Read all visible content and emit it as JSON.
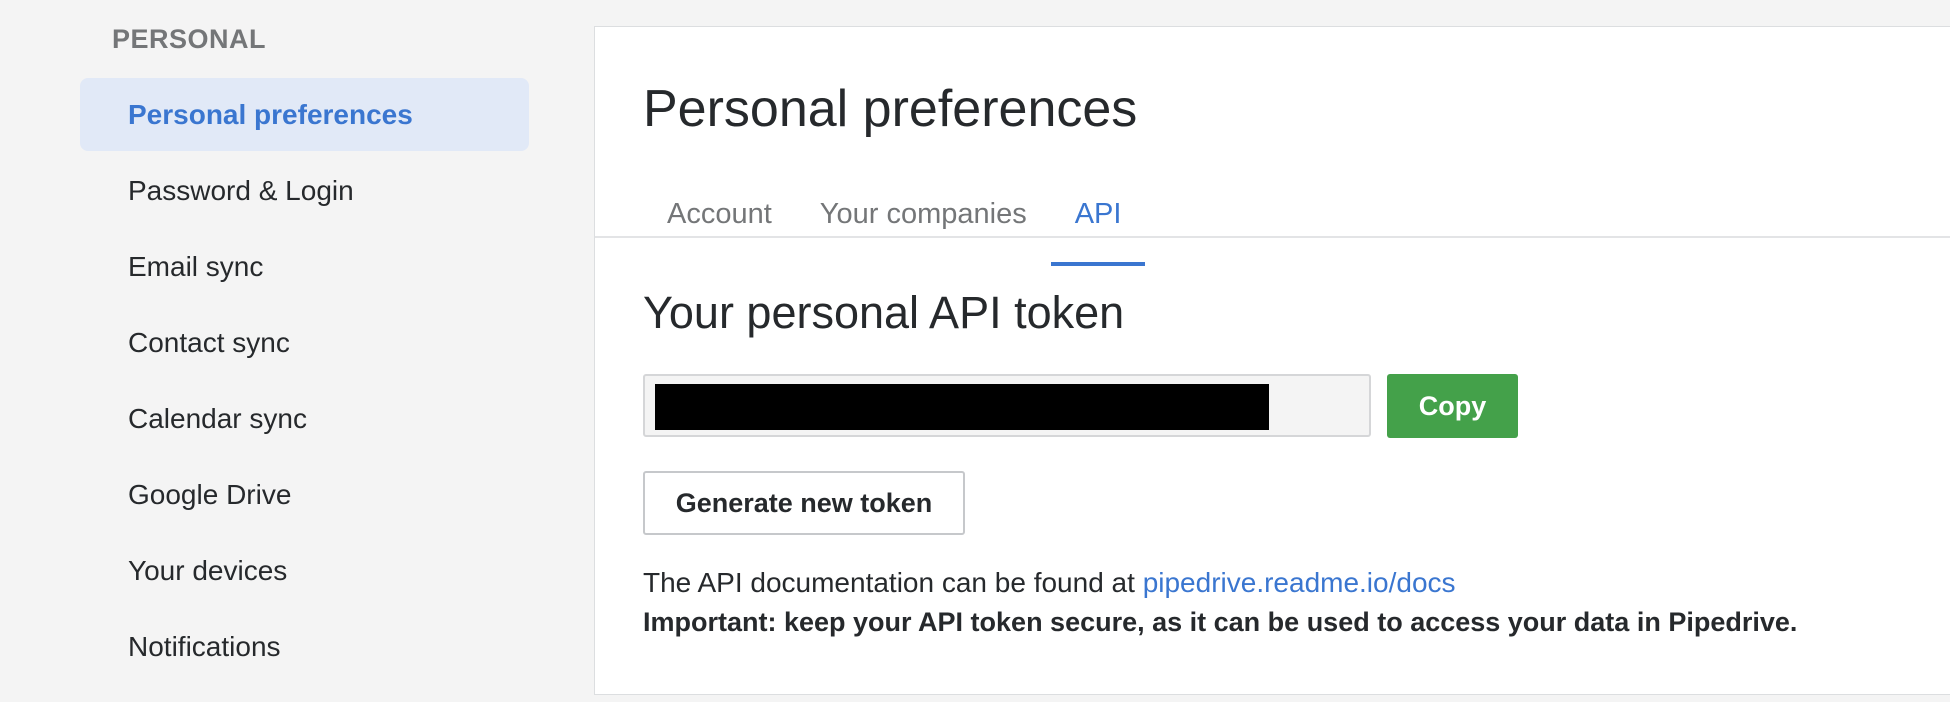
{
  "sidebar": {
    "heading": "PERSONAL",
    "items": [
      {
        "label": "Personal preferences",
        "active": true
      },
      {
        "label": "Password & Login",
        "active": false
      },
      {
        "label": "Email sync",
        "active": false
      },
      {
        "label": "Contact sync",
        "active": false
      },
      {
        "label": "Calendar sync",
        "active": false
      },
      {
        "label": "Google Drive",
        "active": false
      },
      {
        "label": "Your devices",
        "active": false
      },
      {
        "label": "Notifications",
        "active": false
      }
    ]
  },
  "main": {
    "title": "Personal preferences",
    "tabs": [
      {
        "label": "Account",
        "active": false
      },
      {
        "label": "Your companies",
        "active": false
      },
      {
        "label": "API",
        "active": true
      }
    ],
    "api": {
      "section_title": "Your personal API token",
      "token_value": "",
      "copy_label": "Copy",
      "generate_label": "Generate new token",
      "doc_text": "The API documentation can be found at",
      "doc_link": "pipedrive.readme.io/docs",
      "warning": "Important: keep your API token secure, as it can be used to access your data in Pipedrive."
    }
  },
  "colors": {
    "accent": "#3a76d0",
    "active_nav_bg": "#e1e9f7",
    "copy_button": "#44a14a",
    "page_bg": "#f4f4f4"
  }
}
